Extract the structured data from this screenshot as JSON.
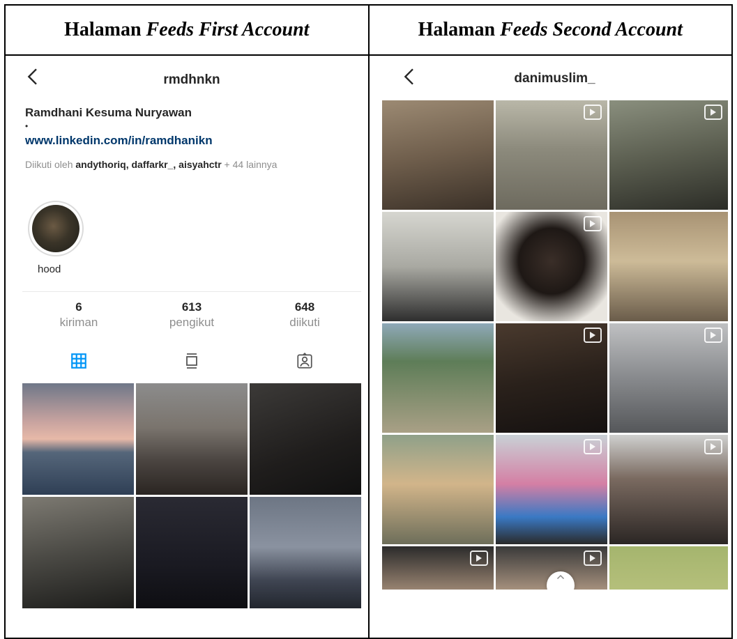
{
  "left_header": {
    "prefix": "Halaman ",
    "italic": "Feeds First Account"
  },
  "right_header": {
    "prefix": "Halaman ",
    "italic": "Feeds Second Account"
  },
  "first_account": {
    "username": "rmdhnkn",
    "full_name": "Ramdhani Kesuma Nuryawan",
    "bio_dot": "•",
    "link": "www.linkedin.com/in/ramdhanikn",
    "followed_by_prefix": "Diikuti oleh ",
    "followed_by_names": "andythoriq, daffarkr_, aisyahctr",
    "followed_by_suffix": " + 44 lainnya",
    "highlight_label": "hood",
    "stats": [
      {
        "num": "6",
        "label": "kiriman"
      },
      {
        "num": "613",
        "label": "pengikut"
      },
      {
        "num": "648",
        "label": "diikuti"
      }
    ],
    "tabs": [
      "grid-icon",
      "feed-icon",
      "tagged-icon"
    ],
    "accent_color": "#0095f6"
  },
  "second_account": {
    "username": "danimuslim_"
  }
}
